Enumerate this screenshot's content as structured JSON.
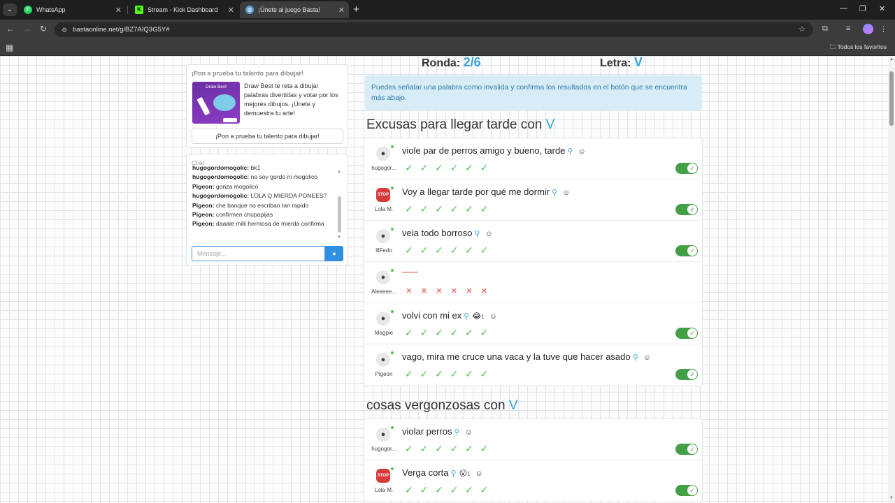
{
  "browser": {
    "tabs": [
      {
        "title": "WhatsApp",
        "icon": "whatsapp-icon"
      },
      {
        "title": "Stream - Kick Dashboard",
        "icon": "kick-icon"
      },
      {
        "title": "¡Únete al juego Basta!",
        "icon": "globe-icon"
      }
    ],
    "url": "bastaonline.net/g/BZ7AIQ3G5Y#",
    "bookmarks_all": "Todos los favoritos"
  },
  "promo": {
    "title": "¡Pon a prueba tu talento para dibujar!",
    "image_caption": "Draw Best",
    "text": "Draw Best te reta a dibujar palabras divertidas y votar por los mejores dibujos. ¡Únete y demuestra tu arte!",
    "button": "¡Pon a prueba tu talento para dibujar!"
  },
  "chat": {
    "label": "Chat",
    "messages": [
      {
        "user": "hugogordomogolic:",
        "text": "bk1"
      },
      {
        "user": "hugogordomogolic:",
        "text": "no soy gordo ni mogolico"
      },
      {
        "user": "Pigeon:",
        "text": "gonza mogolico"
      },
      {
        "user": "hugogordomogolic:",
        "text": "LOLA Q MIERDA PONEES?"
      },
      {
        "user": "Pigeon:",
        "text": "che banque no escriban tan rapido"
      },
      {
        "user": "Pigeon:",
        "text": "confirmen chupapijas"
      },
      {
        "user": "Pigeon:",
        "text": "daaale milli hermosa de mierda confirma"
      }
    ],
    "placeholder": "Mensaje..."
  },
  "game": {
    "round_label": "Ronda:",
    "round_value": "2/6",
    "letter_label": "Letra:",
    "letter_value": "V",
    "info": "Puedes señalar una palabra como invalida y confirma los resultados en el botón que se encuentra más abajo."
  },
  "categories": [
    {
      "title": "Excusas para llegar tarde con",
      "letter": "V",
      "entries": [
        {
          "player": "hugogor...",
          "avatar": "user",
          "answer": "viole par de perros amigo y bueno, tarde",
          "votes": [
            "ok",
            "ok",
            "ok",
            "ok",
            "ok",
            "ok"
          ],
          "valid": true
        },
        {
          "player": "Lola M.",
          "avatar": "stop",
          "answer": "Voy a llegar tarde por qué me dormir",
          "votes": [
            "ok",
            "ok",
            "ok",
            "ok",
            "ok",
            "ok"
          ],
          "valid": true
        },
        {
          "player": "lilFedo",
          "avatar": "user",
          "answer": "veia todo borroso",
          "votes": [
            "ok",
            "ok",
            "ok",
            "ok",
            "ok",
            "ok"
          ],
          "valid": true
        },
        {
          "player": "Aleeeee...",
          "avatar": "user",
          "answer": "",
          "votes": [
            "no",
            "no",
            "no",
            "no",
            "no",
            "no"
          ],
          "valid": false
        },
        {
          "player": "Magpie",
          "avatar": "user",
          "answer": "volvi con mi ex",
          "reaction": "😂",
          "reaction_count": "1",
          "votes": [
            "ok",
            "ok",
            "ok",
            "ok",
            "ok",
            "ok"
          ],
          "valid": true
        },
        {
          "player": "Pigeon",
          "avatar": "user",
          "answer": "vago, mira me cruce una vaca y la tuve que hacer asado",
          "votes": [
            "ok",
            "ok",
            "ok",
            "ok",
            "ok",
            "ok"
          ],
          "valid": true
        }
      ]
    },
    {
      "title": "cosas vergonzosas con",
      "letter": "V",
      "entries": [
        {
          "player": "hugogor...",
          "avatar": "user",
          "answer": "violar perros",
          "votes": [
            "ok",
            "ok",
            "ok",
            "ok",
            "ok",
            "ok"
          ],
          "valid": true
        },
        {
          "player": "Lola M.",
          "avatar": "stop",
          "answer": "Verga corta",
          "reaction": "😮",
          "reaction_count": "1",
          "votes": [
            "ok",
            "ok",
            "ok",
            "ok",
            "ok",
            "ok"
          ],
          "valid": true
        }
      ]
    }
  ],
  "icons": {
    "search": "magnifier-icon",
    "emoji": "emoji-add-icon",
    "check": "check-icon",
    "cross": "cross-icon"
  },
  "colors": {
    "accent": "#3aa3d8",
    "ok": "#4cc04f",
    "no": "#e34848",
    "toggle": "#43a047"
  }
}
